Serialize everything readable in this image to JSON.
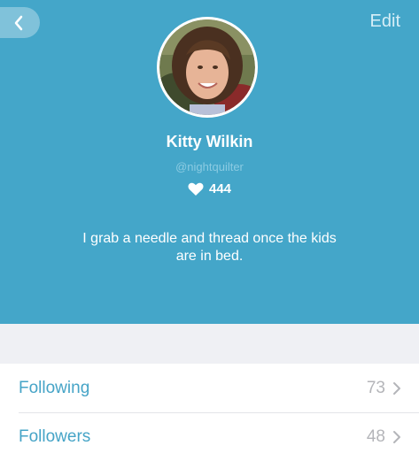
{
  "colors": {
    "header_bg": "#44a6c9",
    "accent": "#46a4c7",
    "page_bg": "#eff0f4"
  },
  "header": {
    "back_icon": "chevron-left-icon",
    "edit_label": "Edit"
  },
  "profile": {
    "name": "Kitty Wilkin",
    "handle": "@nightquilter",
    "likes_icon": "heart-icon",
    "likes": "444",
    "bio": "I grab a needle and thread once the kids are in bed."
  },
  "stats": [
    {
      "label": "Following",
      "count": "73",
      "icon": "chevron-right-icon"
    },
    {
      "label": "Followers",
      "count": "48",
      "icon": "chevron-right-icon"
    }
  ]
}
